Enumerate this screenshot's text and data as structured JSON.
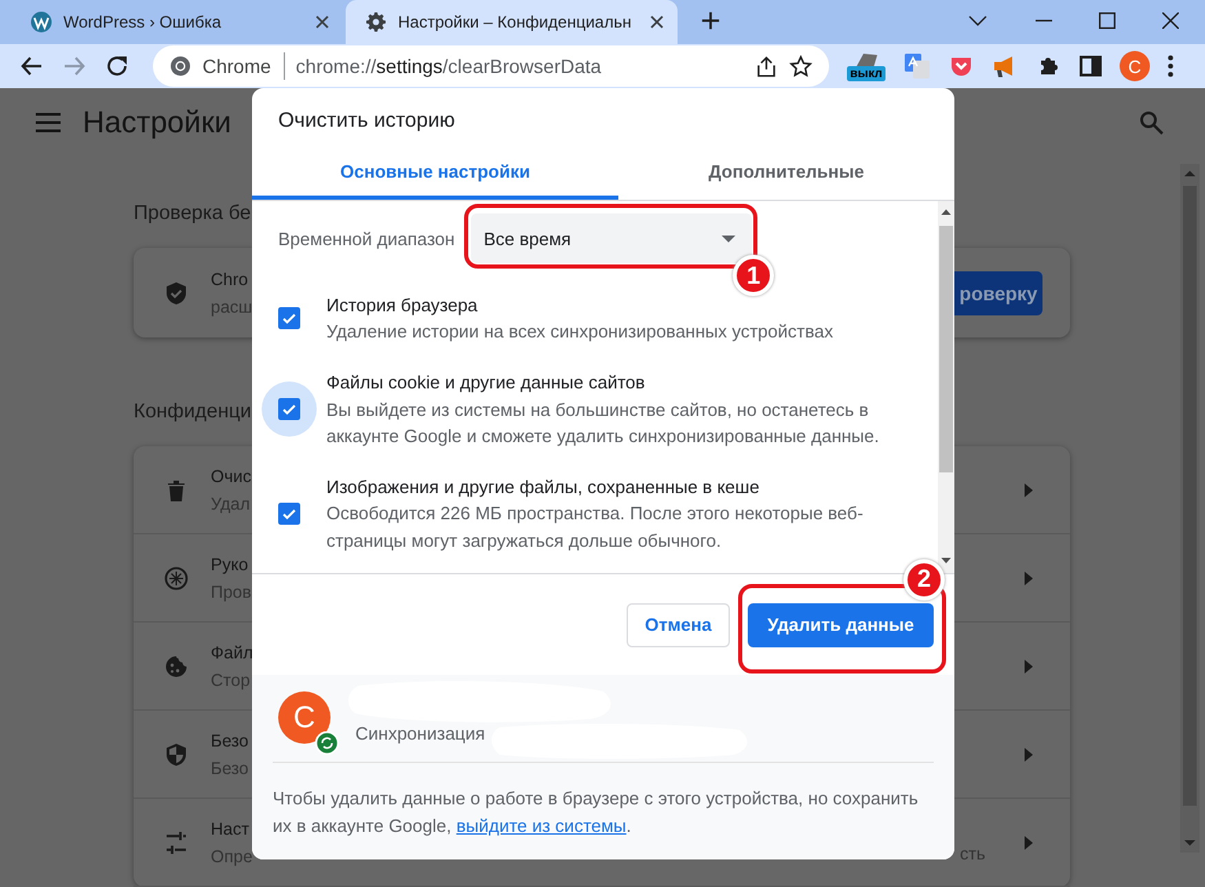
{
  "browser": {
    "tabs": [
      {
        "title": "WordPress › Ошибка",
        "selected": false
      },
      {
        "title": "Настройки – Конфиденциальн",
        "selected": true
      }
    ],
    "address_bar": {
      "site_label": "Chrome",
      "url": [
        {
          "text": "chrome://",
          "strong": false
        },
        {
          "text": "settings",
          "strong": true
        },
        {
          "text": "/clearBrowserData",
          "strong": false
        }
      ]
    },
    "extension_badge": "выкл",
    "profile_initial": "С"
  },
  "settings_page": {
    "title": "Настройки",
    "safety_check": {
      "heading": "Проверка бе",
      "lines": [
        "Chro",
        "расш"
      ],
      "button": "роверку"
    },
    "privacy": {
      "heading": "Конфиденци",
      "rows": [
        {
          "title": "Очис",
          "subtitle": "Удал"
        },
        {
          "title": "Руко",
          "subtitle": "Пров"
        },
        {
          "title": "Файл",
          "subtitle": "Стор"
        },
        {
          "title": "Безо",
          "subtitle": "Безо"
        },
        {
          "title": "Наст",
          "subtitle": "Опре",
          "subtitle_tail": "сть"
        }
      ]
    }
  },
  "dialog": {
    "title": "Очистить историю",
    "tabs": [
      {
        "label": "Основные настройки",
        "selected": true
      },
      {
        "label": "Дополнительные",
        "selected": false
      }
    ],
    "time_range": {
      "label": "Временной диапазон",
      "value": "Все время",
      "annotation": "1"
    },
    "options": [
      {
        "title": "История браузера",
        "description": "Удаление истории на всех синхронизированных устройствах",
        "checked": true,
        "focused": false
      },
      {
        "title": "Файлы cookie и другие данные сайтов",
        "description": "Вы выйдете из системы на большинстве сайтов, но останетесь в аккаунте Google и сможете удалить синхронизированные данные.",
        "checked": true,
        "focused": true
      },
      {
        "title": "Изображения и другие файлы, сохраненные в кеше",
        "description": "Освободится 226 МБ пространства. После этого некоторые веб-страницы могут загружаться дольше обычного.",
        "checked": true,
        "focused": false
      }
    ],
    "buttons": [
      {
        "label": "Отмена",
        "kind": "secondary"
      },
      {
        "label": "Удалить данные",
        "kind": "primary",
        "annotation": "2"
      }
    ],
    "account": {
      "initial": "С",
      "status": "Синхронизация",
      "redacted": true
    },
    "footer_note": {
      "text": "Чтобы удалить данные о работе в браузере с этого устройства, но сохранить их в аккаунте Google, ",
      "link": "выйдите из системы",
      "after": "."
    }
  }
}
